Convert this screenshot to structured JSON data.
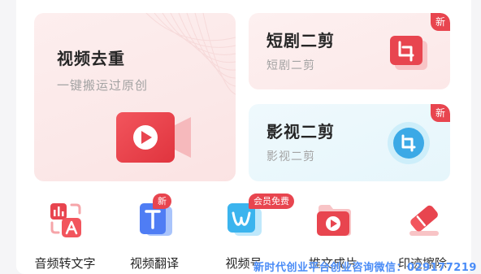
{
  "cards": {
    "video_dedup": {
      "title": "视频去重",
      "subtitle": "一键搬运过原创"
    },
    "short_drama": {
      "title": "短剧二剪",
      "subtitle": "短剧二剪",
      "badge": "新"
    },
    "film_edit": {
      "title": "影视二剪",
      "subtitle": "影视二剪",
      "badge": "新"
    }
  },
  "tools": [
    {
      "label": "音频转文字",
      "icon": "audio-to-text-icon"
    },
    {
      "label": "视频翻译",
      "icon": "video-translate-icon",
      "badge": "新"
    },
    {
      "label": "视频号",
      "icon": "video-account-icon",
      "badge": "会员免费"
    },
    {
      "label": "推文成片",
      "icon": "post-to-video-icon"
    },
    {
      "label": "印迹擦除",
      "icon": "eraser-icon"
    }
  ],
  "watermark": "新时代创业平台创业咨询微信：029177219",
  "colors": {
    "accent": "#e8454f",
    "blue": "#3ba9e6",
    "text": "#262626",
    "subtext": "#a3a3a3"
  }
}
